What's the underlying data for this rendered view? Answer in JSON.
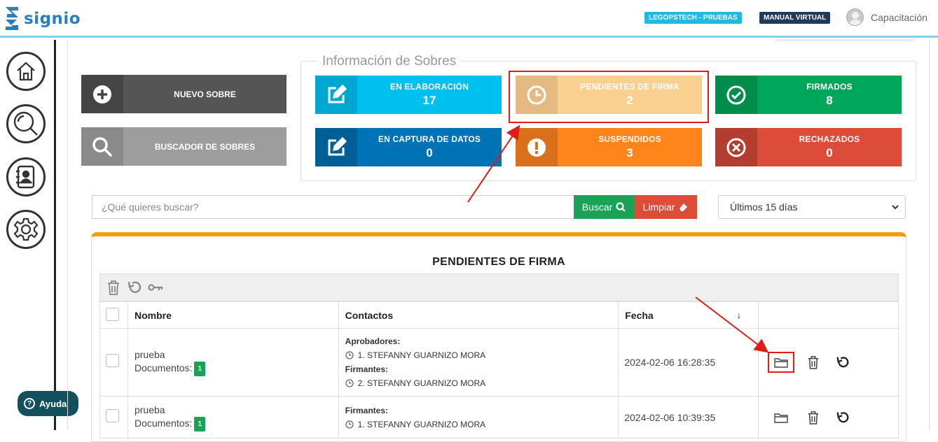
{
  "header": {
    "brand": "signio",
    "env_badge": "LEGOPSTECH - PRUEBAS",
    "manual_badge": "MANUAL VIRTUAL",
    "user_name": "Capacitación"
  },
  "sidebar": {
    "items": [
      {
        "name": "home-icon"
      },
      {
        "name": "search-icon"
      },
      {
        "name": "contacts-icon"
      },
      {
        "name": "gear-icon"
      }
    ],
    "help_label": "Ayuda"
  },
  "actions": {
    "new_label": "NUEVO SOBRE",
    "search_label": "BUSCADOR DE SOBRES"
  },
  "info": {
    "title": "Información de Sobres",
    "tiles": [
      {
        "label": "EN ELABORACIÓN",
        "value": "17",
        "color": "#00c0ef",
        "icon_bg": "#00a7d0"
      },
      {
        "label": "PENDIENTES DE FIRMA",
        "value": "2",
        "color": "#f9d08f",
        "icon_bg": "#e3bb82"
      },
      {
        "label": "FIRMADOS",
        "value": "8",
        "color": "#00a65a",
        "icon_bg": "#008d4c"
      },
      {
        "label": "EN CAPTURA DE DATOS",
        "value": "0",
        "color": "#0073b7",
        "icon_bg": "#005f96"
      },
      {
        "label": "SUSPENDIDOS",
        "value": "3",
        "color": "#ff851b",
        "icon_bg": "#d9711a"
      },
      {
        "label": "RECHAZADOS",
        "value": "0",
        "color": "#dd4b39",
        "icon_bg": "#b53d2f"
      }
    ]
  },
  "search": {
    "placeholder": "¿Qué quieres buscar?",
    "buscar_label": "Buscar",
    "limpiar_label": "Limpiar",
    "period": "Últimos 15 días"
  },
  "table": {
    "title": "PENDIENTES DE FIRMA",
    "columns": [
      "Nombre",
      "Contactos",
      "Fecha"
    ],
    "rows": [
      {
        "name": "prueba",
        "docs_label": "Documentos:",
        "docs_count": "1",
        "groups": [
          {
            "head": "Aprobadores:",
            "items": [
              "1. STEFANNY GUARNIZO MORA"
            ]
          },
          {
            "head": "Firmantes:",
            "items": [
              "2. STEFANNY GUARNIZO MORA"
            ]
          }
        ],
        "date": "2024-02-06 16:28:35"
      },
      {
        "name": "prueba",
        "docs_label": "Documentos:",
        "docs_count": "1",
        "groups": [
          {
            "head": "Firmantes:",
            "items": [
              "1. STEFANNY GUARNIZO MORA"
            ]
          }
        ],
        "date": "2024-02-06 10:39:35"
      }
    ]
  },
  "colors": {
    "accent": "#f39c12",
    "highlight": "#e01b1b",
    "buscar": "#1aa257",
    "limpiar": "#dd4b39"
  }
}
